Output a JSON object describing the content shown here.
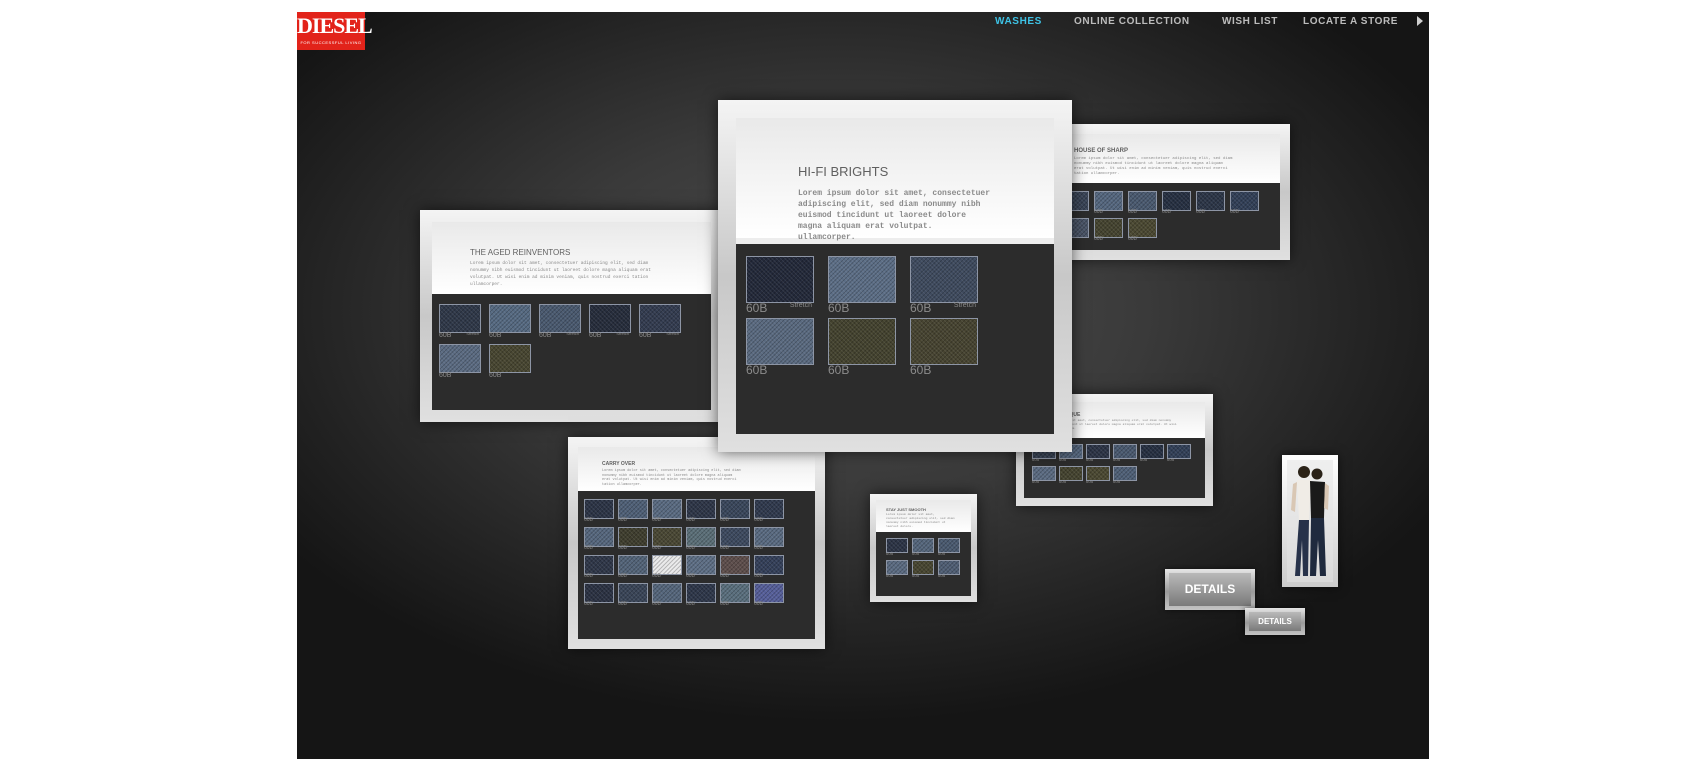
{
  "logo": {
    "wordmark": "DIESEL",
    "tagline": "FOR SUCCESSFUL LIVING"
  },
  "nav": {
    "items": [
      {
        "label": "WASHES",
        "active": true
      },
      {
        "label": "ONLINE COLLECTION",
        "active": false
      },
      {
        "label": "WISH LIST",
        "active": false
      },
      {
        "label": "LOCATE A STORE",
        "active": false
      }
    ],
    "arrow_icon": "play-arrow-icon"
  },
  "colors": {
    "active_nav": "#3ec3e6",
    "logo_red": "#e2231a",
    "panel_dark": "#2c2c2c"
  },
  "boxes": {
    "hifi": {
      "title": "HI-FI BRIGHTS",
      "body": "Lorem ipsum dolor sit amet, consectetuer adipiscing elit, sed diam nonummy nibh euismod tincidunt ut laoreet dolore magna aliquam erat volutpat. ullamcorper.",
      "swatches": [
        {
          "label": "60B",
          "sub": "Stretch",
          "color": "#23293a"
        },
        {
          "label": "60B",
          "sub": "",
          "color": "#5c6e86"
        },
        {
          "label": "60B",
          "sub": "Stretch",
          "color": "#3f4b5f"
        },
        {
          "label": "60B",
          "sub": "",
          "color": "#5a6a80"
        },
        {
          "label": "60B",
          "sub": "",
          "color": "#44432f"
        },
        {
          "label": "60B",
          "sub": "",
          "color": "#474431"
        }
      ]
    },
    "aged": {
      "title": "THE AGED REINVENTORS",
      "body": "Lorem ipsum dolor sit amet, consectetuer adipiscing elit, sed diam nonummy nibh euismod tincidunt ut laoreet dolore magna aliquam erat volutpat. Ut wisi enim ad minim veniam, quis nostrud exerci tation ullamcorper.",
      "swatches": [
        {
          "label": "60B",
          "sub": "Stretch",
          "color": "#2f3849"
        },
        {
          "label": "60B",
          "sub": "",
          "color": "#566a82"
        },
        {
          "label": "60B",
          "sub": "Stretch",
          "color": "#4a5a70"
        },
        {
          "label": "60B",
          "sub": "Stretch",
          "color": "#262d3c"
        },
        {
          "label": "60B",
          "sub": "Stretch",
          "color": "#333c50"
        },
        {
          "label": "60B",
          "sub": "",
          "color": "#5b6b82"
        },
        {
          "label": "60B",
          "sub": "",
          "color": "#484631"
        }
      ]
    },
    "sharp": {
      "title": "HOUSE OF SHARP",
      "body": "Lorem ipsum dolor sit amet, consectetuer adipiscing elit, sed diam nonummy nibh euismod tincidunt ut laoreet dolore magna aliquam erat volutpat. Ut wisi enim ad minim veniam, quis nostrud exerci tation ullamcorper.",
      "swatches": [
        {
          "label": "60B",
          "sub": "",
          "color": "#3a4558"
        },
        {
          "label": "60B",
          "sub": "",
          "color": "#55677f"
        },
        {
          "label": "60B",
          "sub": "",
          "color": "#4a5a70"
        },
        {
          "label": "60B",
          "sub": "",
          "color": "#263042"
        },
        {
          "label": "60B",
          "sub": "",
          "color": "#2c3648"
        },
        {
          "label": "60B",
          "sub": "",
          "color": "#324058"
        },
        {
          "label": "60B",
          "sub": "",
          "color": "#4a5568"
        },
        {
          "label": "60B",
          "sub": "",
          "color": "#454430"
        },
        {
          "label": "60B",
          "sub": "",
          "color": "#4b4932"
        }
      ]
    },
    "carry": {
      "title": "CARRY OVER",
      "body": "Lorem ipsum dolor sit amet, consectetuer adipiscing elit, sed diam nonummy nibh euismod tincidunt ut laoreet dolore magna aliquam erat volutpat. Ut wisi enim ad minim veniam, quis nostrud exerci tation ullamcorper.",
      "swatches": [
        {
          "label": "60B",
          "sub": "",
          "color": "#2c3446"
        },
        {
          "label": "60B",
          "sub": "",
          "color": "#4f6077"
        },
        {
          "label": "60B",
          "sub": "",
          "color": "#5a6b82"
        },
        {
          "label": "60B",
          "sub": "",
          "color": "#2e3648"
        },
        {
          "label": "60B",
          "sub": "",
          "color": "#3a475c"
        },
        {
          "label": "60B",
          "sub": "",
          "color": "#303a4e"
        },
        {
          "label": "60B",
          "sub": "",
          "color": "#56677e"
        },
        {
          "label": "60B",
          "sub": "",
          "color": "#3f3e2e"
        },
        {
          "label": "60B",
          "sub": "",
          "color": "#4a4834"
        },
        {
          "label": "60B",
          "sub": "",
          "color": "#5b6f78"
        },
        {
          "label": "60B",
          "sub": "",
          "color": "#3d4a60"
        },
        {
          "label": "60B",
          "sub": "",
          "color": "#5a6b82"
        },
        {
          "label": "60B",
          "sub": "",
          "color": "#2f3749"
        },
        {
          "label": "60B",
          "sub": "",
          "color": "#536479"
        },
        {
          "label": "60B",
          "sub": "",
          "color": "#e9e9ea"
        },
        {
          "label": "60B",
          "sub": "",
          "color": "#5e6f86"
        },
        {
          "label": "60B",
          "sub": "",
          "color": "#5e4e4c"
        },
        {
          "label": "60B",
          "sub": "",
          "color": "#34405a"
        },
        {
          "label": "60B",
          "sub": "",
          "color": "#2b3243"
        },
        {
          "label": "60B",
          "sub": "",
          "color": "#3a4558"
        },
        {
          "label": "60B",
          "sub": "",
          "color": "#55667c"
        },
        {
          "label": "60B",
          "sub": "",
          "color": "#2e374a"
        },
        {
          "label": "60B",
          "sub": "",
          "color": "#5a6f7e"
        },
        {
          "label": "60B",
          "sub": "",
          "color": "#565f9a"
        }
      ]
    },
    "stay": {
      "title": "STAY JUST SMOOTH",
      "body": "Lorem ipsum dolor sit amet, consectetuer adipiscing elit, sed diam nonummy nibh euismod tincidunt ut laoreet dolore.",
      "swatches": [
        {
          "label": "60B",
          "sub": "",
          "color": "#2c3446"
        },
        {
          "label": "60B",
          "sub": "",
          "color": "#55667c"
        },
        {
          "label": "60B",
          "sub": "",
          "color": "#4a5a70"
        },
        {
          "label": "60B",
          "sub": "",
          "color": "#5b6b82"
        },
        {
          "label": "60B",
          "sub": "",
          "color": "#484631"
        },
        {
          "label": "60B",
          "sub": "",
          "color": "#4f5e74"
        }
      ]
    },
    "antique": {
      "title": "ART OF ANTIQUE",
      "body": "Lorem ipsum dolor sit amet, consectetuer adipiscing elit, sed diam nonummy nibh euismod tincidunt ut laoreet dolore magna aliquam erat volutpat. Ut wisi enim ad minim veniam.",
      "swatches": [
        {
          "label": "60B",
          "sub": "",
          "color": "#3a4558"
        },
        {
          "label": "60B",
          "sub": "",
          "color": "#55677f"
        },
        {
          "label": "60B",
          "sub": "",
          "color": "#2c3446"
        },
        {
          "label": "60B",
          "sub": "",
          "color": "#4a5a70"
        },
        {
          "label": "60B",
          "sub": "",
          "color": "#263042"
        },
        {
          "label": "60B",
          "sub": "",
          "color": "#324058"
        },
        {
          "label": "60B",
          "sub": "",
          "color": "#5b6b82"
        },
        {
          "label": "60B",
          "sub": "",
          "color": "#454430"
        },
        {
          "label": "60B",
          "sub": "",
          "color": "#4b4932"
        },
        {
          "label": "60B",
          "sub": "",
          "color": "#4f6077"
        }
      ]
    }
  },
  "details": {
    "large": "DETAILS",
    "small": "DETAILS"
  }
}
